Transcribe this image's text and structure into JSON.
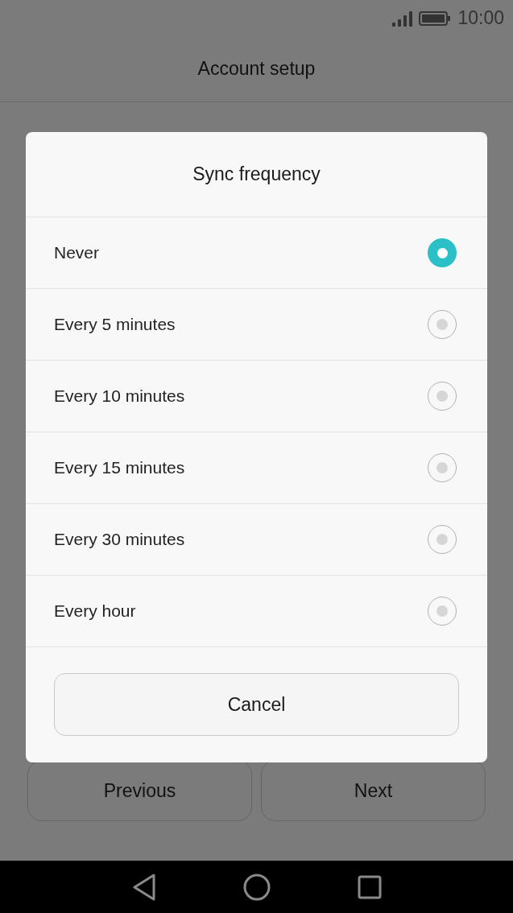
{
  "status_bar": {
    "time": "10:00"
  },
  "header": {
    "title": "Account setup"
  },
  "footer_buttons": [
    "Previous",
    "Next"
  ],
  "dialog": {
    "title": "Sync frequency",
    "options": [
      {
        "label": "Never",
        "selected": true
      },
      {
        "label": "Every 5 minutes",
        "selected": false
      },
      {
        "label": "Every 10 minutes",
        "selected": false
      },
      {
        "label": "Every 15 minutes",
        "selected": false
      },
      {
        "label": "Every 30 minutes",
        "selected": false
      },
      {
        "label": "Every hour",
        "selected": false
      }
    ],
    "cancel": "Cancel"
  }
}
